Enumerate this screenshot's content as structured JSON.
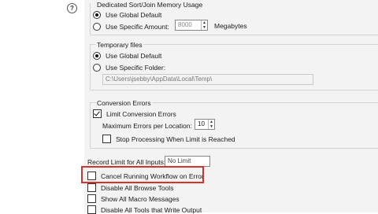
{
  "help_icon_glyph": "?",
  "sort_join": {
    "title": "Dedicated Sort/Join Memory Usage",
    "use_global_default": "Use Global Default",
    "use_specific_amount": "Use Specific Amount:",
    "amount_value": "8000",
    "units": "Megabytes",
    "selected": "use_global_default"
  },
  "temp_files": {
    "title": "Temporary files",
    "use_global_default": "Use Global Default",
    "use_specific_folder": "Use Specific Folder:",
    "folder_path": "C:\\Users\\jsebby\\AppData\\Local\\Temp\\",
    "selected": "use_global_default"
  },
  "conversion_errors": {
    "title": "Conversion Errors",
    "limit_label": "Limit Conversion Errors",
    "limit_checked": true,
    "max_errors_label": "Maximum Errors per Location:",
    "max_errors_value": "10",
    "stop_label": "Stop Processing When Limit is Reached",
    "stop_checked": false
  },
  "record_limit": {
    "label": "Record Limit for All Inputs:",
    "value": "No Limit"
  },
  "options": [
    {
      "label": "Cancel Running Workflow on Error",
      "checked": false,
      "highlighted": true
    },
    {
      "label": "Disable All Browse Tools",
      "checked": false
    },
    {
      "label": "Show All Macro Messages",
      "checked": false
    },
    {
      "label": "Disable All Tools that Write Output",
      "checked": false
    }
  ],
  "colors": {
    "highlight_border": "#d9312a",
    "panel_bg": "#f3f3f3"
  }
}
